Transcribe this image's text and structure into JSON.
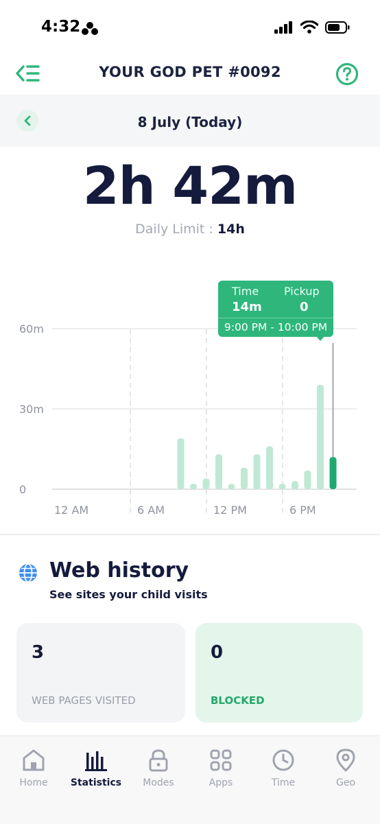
{
  "status_bar": {
    "time": "4:32"
  },
  "header": {
    "title": "YOUR GOD PET #0092"
  },
  "date_bar": {
    "date": "8 July (Today)"
  },
  "summary": {
    "total_time": "2h 42m",
    "limit_label": "Daily Limit :",
    "limit_value": "14h"
  },
  "tooltip": {
    "time_label": "Time",
    "time_value": "14m",
    "pickup_label": "Pickup",
    "pickup_value": "0",
    "range": "9:00 PM - 10:00 PM"
  },
  "chart_data": {
    "type": "bar",
    "x_unit": "hour of day",
    "y_unit": "minutes",
    "ylim": [
      0,
      60
    ],
    "y_ticks": [
      {
        "value": 0,
        "label": "0"
      },
      {
        "value": 30,
        "label": "30m"
      },
      {
        "value": 60,
        "label": "60m"
      }
    ],
    "x_ticks": [
      {
        "hour": 0,
        "label": "12 AM"
      },
      {
        "hour": 6,
        "label": "6 AM"
      },
      {
        "hour": 12,
        "label": "12 PM"
      },
      {
        "hour": 18,
        "label": "6 PM"
      }
    ],
    "hours": [
      9,
      10,
      11,
      12,
      13,
      14,
      15,
      16,
      17,
      18,
      19,
      20,
      21
    ],
    "values": [
      19,
      2,
      4,
      13,
      2,
      8,
      13,
      16,
      2,
      3,
      7,
      39,
      12
    ],
    "selected_hour": 21,
    "grid": true,
    "colors": {
      "bar": "#bfe8d5",
      "selected": "#1faa6d"
    }
  },
  "web_history": {
    "title": "Web history",
    "subtitle": "See sites your child visits",
    "visited_count": "3",
    "visited_label": "WEB PAGES VISITED",
    "blocked_count": "0",
    "blocked_label": "BLOCKED"
  },
  "nav": {
    "items": [
      {
        "label": "Home",
        "icon": "home-icon"
      },
      {
        "label": "Statistics",
        "icon": "bar-chart-icon"
      },
      {
        "label": "Modes",
        "icon": "lock-icon"
      },
      {
        "label": "Apps",
        "icon": "apps-grid-icon"
      },
      {
        "label": "Time",
        "icon": "clock-icon"
      },
      {
        "label": "Geo",
        "icon": "location-pin-icon"
      }
    ]
  },
  "colors": {
    "accent": "#2fb67b",
    "dark": "#151b3c",
    "muted": "#a3a8b4"
  }
}
